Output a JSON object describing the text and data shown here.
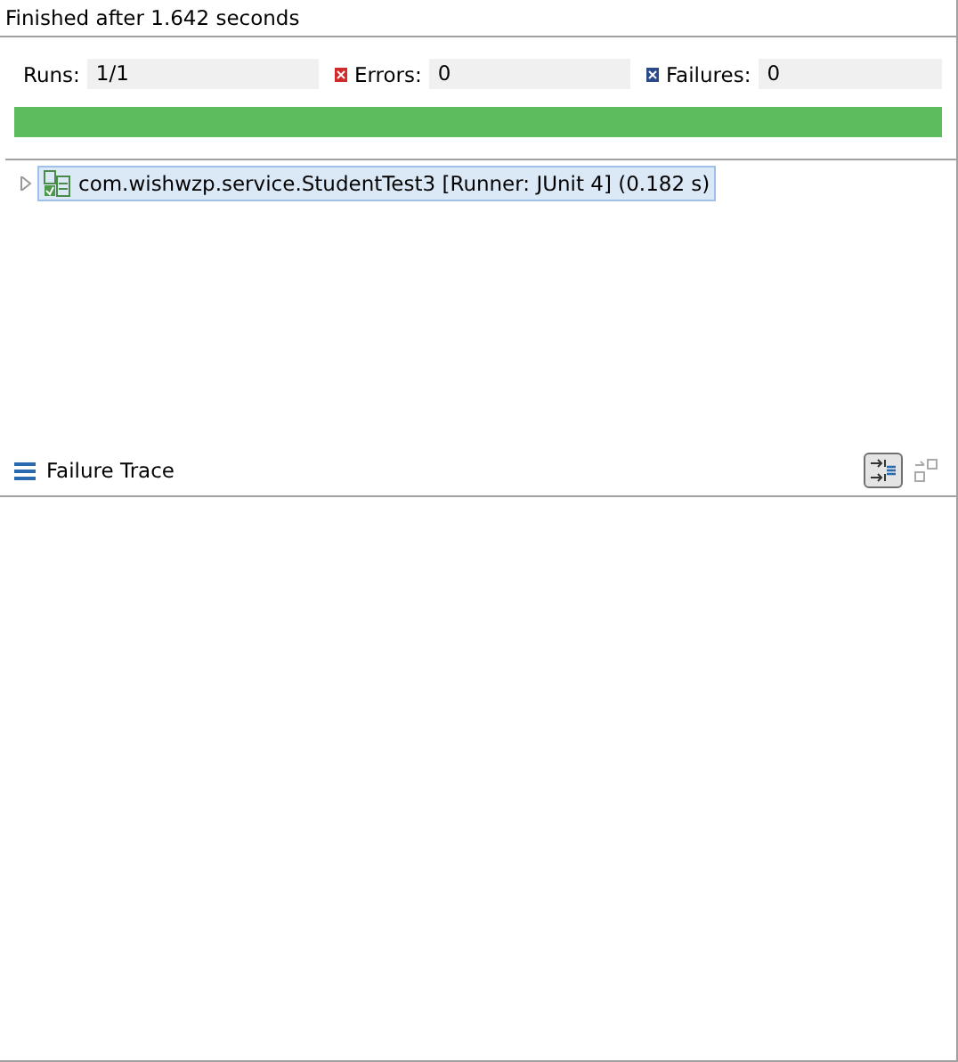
{
  "status": {
    "text": "Finished after 1.642 seconds"
  },
  "counters": [
    {
      "kind": "runs",
      "label": "Runs:",
      "value": "1/1"
    },
    {
      "kind": "errors",
      "label": "Errors:",
      "value": "0"
    },
    {
      "kind": "failures",
      "label": "Failures:",
      "value": "0"
    }
  ],
  "progress": {
    "level": 1
  },
  "tree": [
    {
      "label": "com.wishwzp.service.StudentTest3 [Runner: JUnit 4] (0.182 s)",
      "expanded": false,
      "selected": true
    }
  ],
  "failure_trace": {
    "title": "Failure Trace",
    "toolbar": [
      {
        "kind": "filter",
        "selected": true
      },
      {
        "kind": "compare",
        "selected": false
      }
    ]
  }
}
